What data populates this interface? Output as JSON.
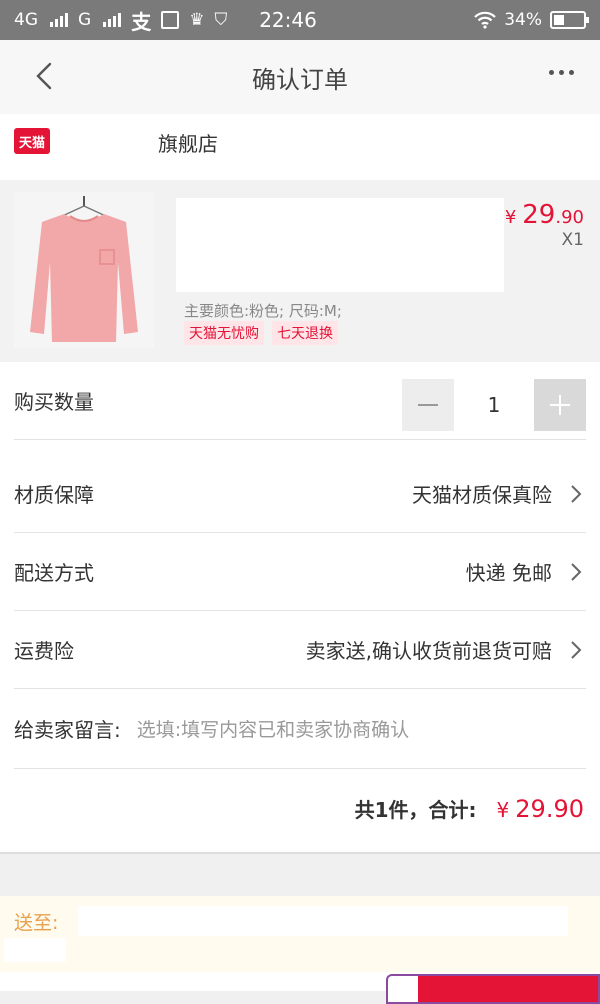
{
  "status_bar": {
    "net1": "4G",
    "net2": "G",
    "time": "22:46",
    "battery_text": "34%",
    "battery_level": 0.34
  },
  "nav": {
    "title": "确认订单",
    "back_icon": "chevron-left-icon",
    "more_icon": "more-dots-icon"
  },
  "shop": {
    "badge": "天猫",
    "name": "旗舰店"
  },
  "product": {
    "price_symbol": "¥",
    "price_int": "29",
    "price_dec": ".90",
    "quantity_tag": "X1",
    "attrs": "主要颜色:粉色; 尺码:M;",
    "tags": [
      "天猫无忧购",
      "七天退换"
    ]
  },
  "rows": {
    "quantity_label": "购买数量",
    "quantity_value": "1",
    "material_label": "材质保障",
    "material_value": "天猫材质保真险",
    "delivery_label": "配送方式",
    "delivery_value": "快递 免邮",
    "insurance_label": "运费险",
    "insurance_value": "卖家送,确认收货前退货可赔",
    "message_label": "给卖家留言:",
    "message_placeholder": "选填:填写内容已和卖家协商确认"
  },
  "summary": {
    "count_text": "共1件，合计:",
    "price_symbol": "¥",
    "total": "29.90"
  },
  "address": {
    "label": "送至:"
  },
  "colors": {
    "accent": "#e31436",
    "address_label": "#e8a050"
  }
}
